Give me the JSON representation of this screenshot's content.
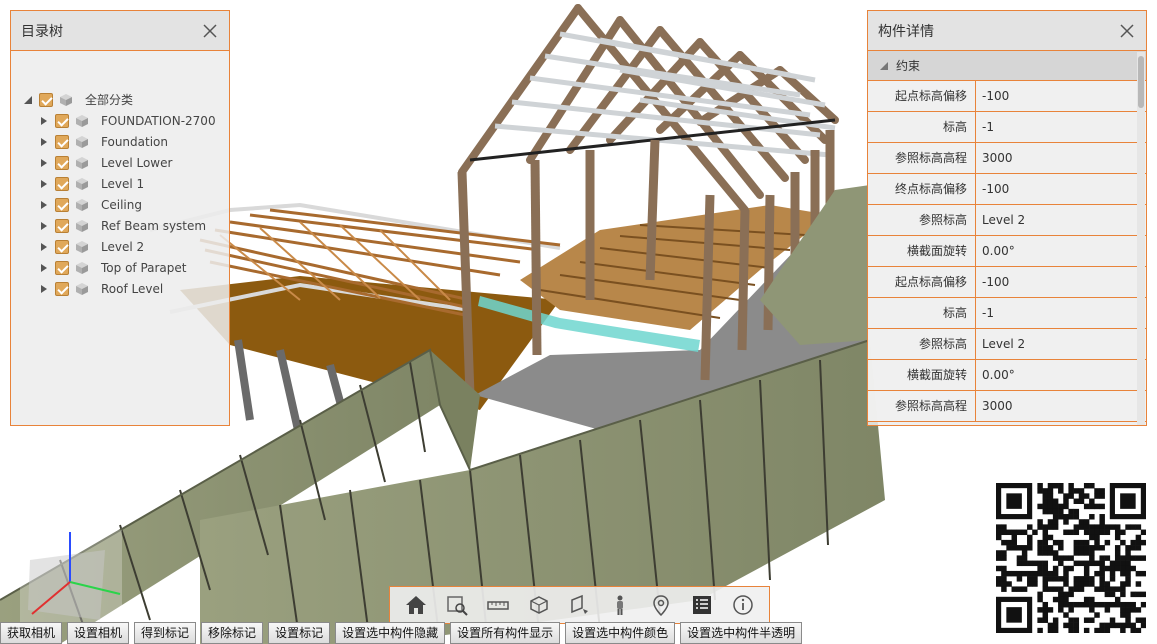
{
  "tree_panel": {
    "title": "目录树",
    "root_label": "全部分类",
    "items": [
      {
        "label": "FOUNDATION-2700"
      },
      {
        "label": "Foundation"
      },
      {
        "label": "Level Lower"
      },
      {
        "label": "Level 1"
      },
      {
        "label": "Ceiling"
      },
      {
        "label": "Ref Beam system"
      },
      {
        "label": "Level 2"
      },
      {
        "label": "Top of Parapet"
      },
      {
        "label": "Roof Level"
      }
    ]
  },
  "detail_panel": {
    "title": "构件详情",
    "group_label": "约束",
    "rows": [
      {
        "name": "起点标高偏移",
        "value": "-100"
      },
      {
        "name": "标高",
        "value": "-1"
      },
      {
        "name": "参照标高高程",
        "value": "3000"
      },
      {
        "name": "终点标高偏移",
        "value": "-100"
      },
      {
        "name": "参照标高",
        "value": "Level 2"
      },
      {
        "name": "横截面旋转",
        "value": "0.00°"
      },
      {
        "name": "起点标高偏移",
        "value": "-100"
      },
      {
        "name": "标高",
        "value": "-1"
      },
      {
        "name": "参照标高",
        "value": "Level 2"
      },
      {
        "name": "横截面旋转",
        "value": "0.00°"
      },
      {
        "name": "参照标高高程",
        "value": "3000"
      }
    ]
  },
  "toolbar": {
    "tools": [
      "home-icon",
      "zoom-window-icon",
      "measure-ruler-icon",
      "section-box-icon",
      "section-plane-icon",
      "walk-person-icon",
      "location-pin-icon",
      "properties-list-icon",
      "info-icon"
    ]
  },
  "buttons": [
    {
      "label": "获取相机"
    },
    {
      "label": "设置相机"
    },
    {
      "label": "得到标记"
    },
    {
      "label": "移除标记"
    },
    {
      "label": "设置标记"
    },
    {
      "label": "设置选中构件隐藏"
    },
    {
      "label": "设置所有构件显示"
    },
    {
      "label": "设置选中构件颜色"
    },
    {
      "label": "设置选中构件半透明"
    }
  ],
  "colors": {
    "accent": "#e8833a",
    "checkbox": "#e0a85a",
    "wall_green": "#8c9372",
    "timber": "#8a6f56",
    "floor_brown": "#8c5a0f",
    "selected_beam": "#6ed6cf"
  }
}
